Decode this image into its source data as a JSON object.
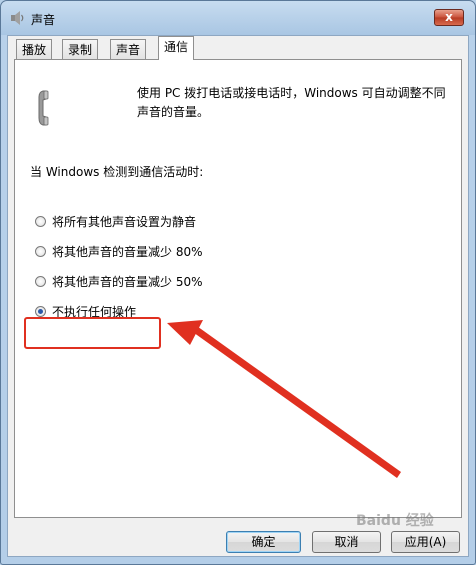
{
  "window": {
    "title": "声音",
    "close_glyph": "x"
  },
  "tabs": [
    {
      "label": "播放"
    },
    {
      "label": "录制"
    },
    {
      "label": "声音"
    },
    {
      "label": "通信"
    }
  ],
  "communications": {
    "description": "使用 PC 拨打电话或接电话时，Windows 可自动调整不同声音的音量。",
    "section_label": "当 Windows 检测到通信活动时:",
    "options": [
      {
        "label": "将所有其他声音设置为静音",
        "checked": false
      },
      {
        "label": "将其他声音的音量减少 80%",
        "checked": false
      },
      {
        "label": "将其他声音的音量减少 50%",
        "checked": false
      },
      {
        "label": "不执行任何操作",
        "checked": true
      }
    ]
  },
  "buttons": {
    "ok": "确定",
    "cancel": "取消",
    "apply": "应用(A)"
  },
  "watermark": "Baidu 经验",
  "colors": {
    "annotation": "#e03020",
    "accent": "#2a58a8"
  }
}
